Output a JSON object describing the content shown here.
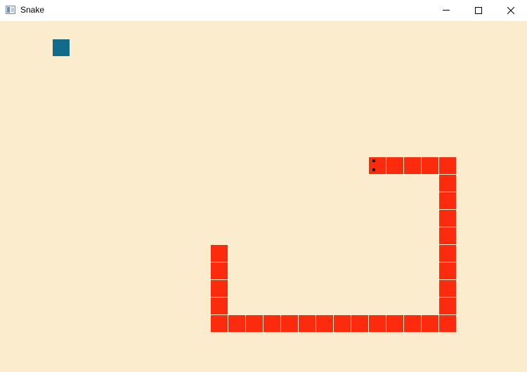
{
  "window": {
    "title": "Snake"
  },
  "colors": {
    "background": "#fcecce",
    "snake": "#fd2b0d",
    "food": "#136b8c",
    "eyes": "#000000"
  },
  "game": {
    "direction": "left",
    "length": 31
  }
}
